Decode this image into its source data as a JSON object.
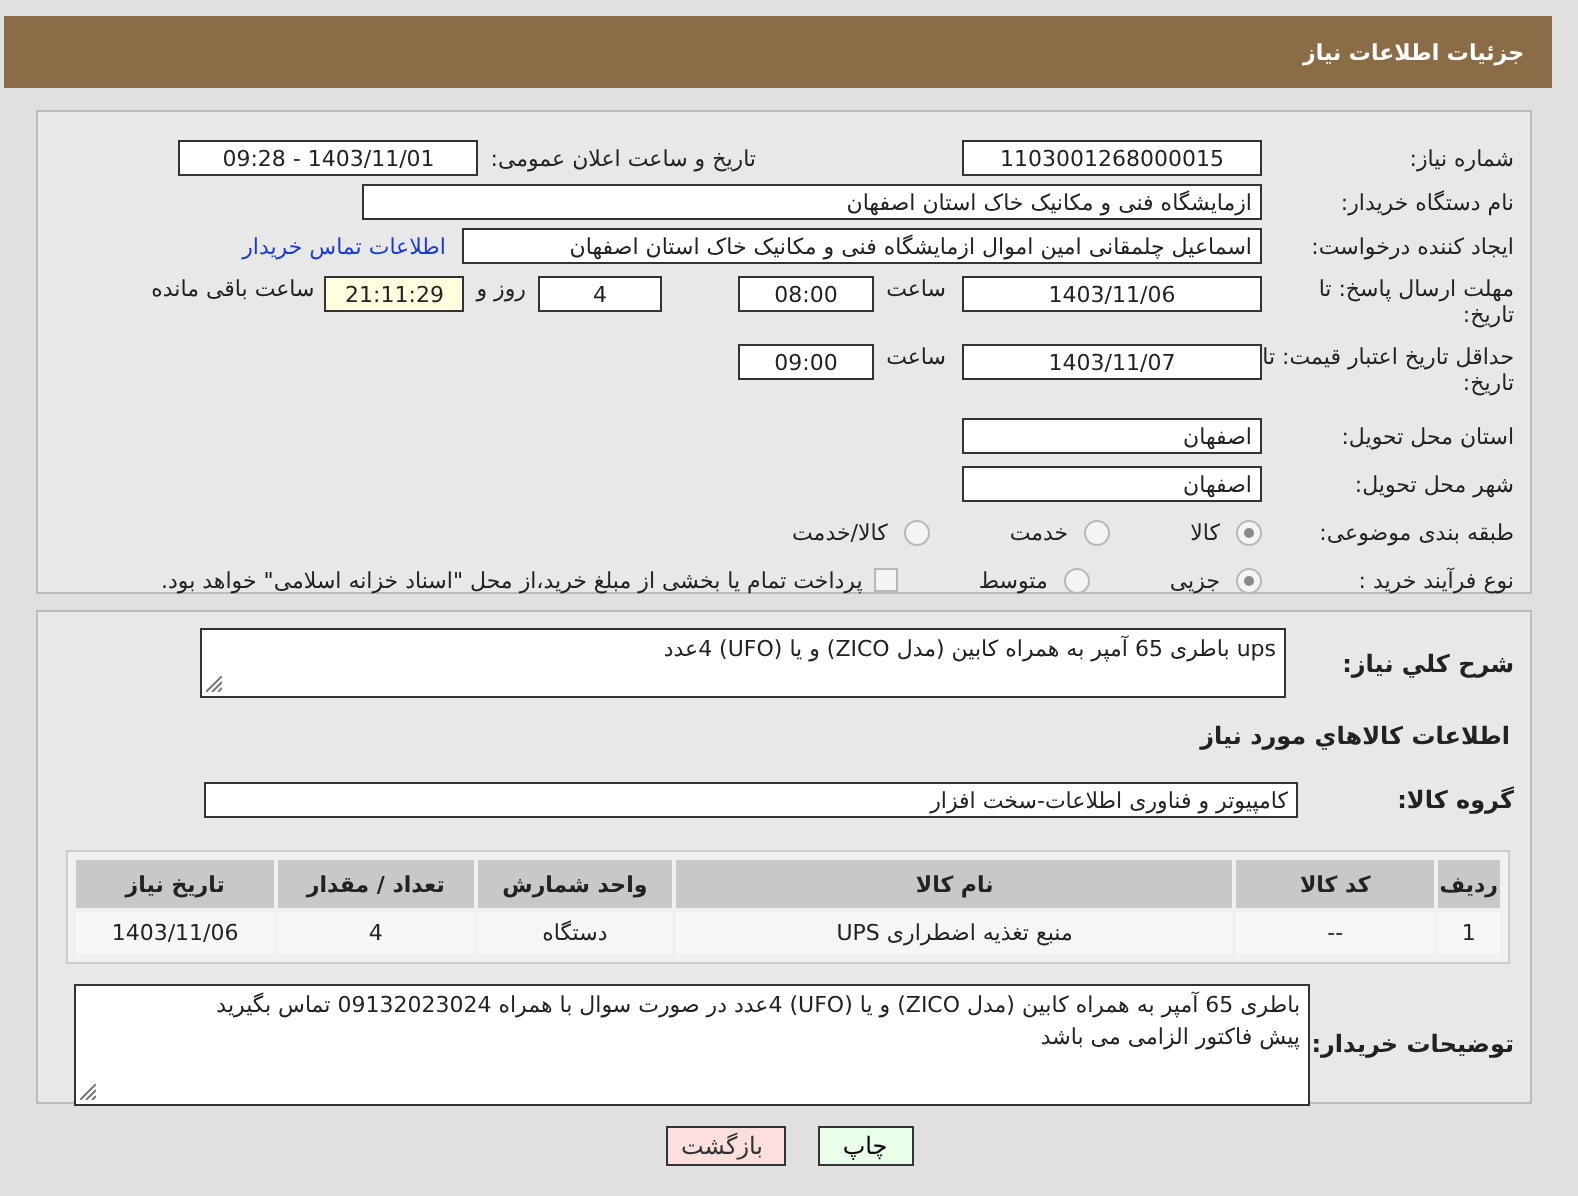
{
  "header": {
    "title": "جزئیات اطلاعات نیاز"
  },
  "need_number": {
    "label": "شماره نیاز:",
    "value": "1103001268000015"
  },
  "announce": {
    "label": "تاریخ و ساعت اعلان عمومی:",
    "value": "1403/11/01 - 09:28"
  },
  "buyer_org": {
    "label": "نام دستگاه خریدار:",
    "value": "ازمایشگاه فنی و مکانیک خاک استان اصفهان"
  },
  "requester": {
    "label": "ایجاد کننده درخواست:",
    "value": "اسماعیل چلمقانی امین اموال ازمایشگاه فنی و مکانیک خاک استان اصفهان",
    "link": "اطلاعات تماس خریدار"
  },
  "reply_deadline": {
    "label": "مهلت ارسال پاسخ: تا تاریخ:",
    "date": "1403/11/06",
    "time_label": "ساعت",
    "time": "08:00",
    "days": "4",
    "days_label": "روز و",
    "remaining": "21:11:29",
    "remaining_label": "ساعت باقی مانده"
  },
  "price_validity": {
    "label": "حداقل تاریخ اعتبار قیمت: تا تاریخ:",
    "date": "1403/11/07",
    "time_label": "ساعت",
    "time": "09:00"
  },
  "province": {
    "label": "استان محل تحویل:",
    "value": "اصفهان"
  },
  "city": {
    "label": "شهر محل تحویل:",
    "value": "اصفهان"
  },
  "category": {
    "label": "طبقه بندی موضوعی:",
    "options": [
      {
        "label": "کالا",
        "selected": true
      },
      {
        "label": "خدمت",
        "selected": false
      },
      {
        "label": "کالا/خدمت",
        "selected": false
      }
    ]
  },
  "purchase_type": {
    "label": "نوع فرآیند خرید :",
    "options": [
      {
        "label": "جزیی",
        "selected": true
      },
      {
        "label": "متوسط",
        "selected": false
      }
    ],
    "payment": {
      "checked": false,
      "text": "پرداخت تمام یا بخشی از مبلغ خرید،از محل \"اسناد خزانه اسلامی\" خواهد بود."
    }
  },
  "description": {
    "label": "شرح کلي نياز:",
    "value": "ups باطری 65 آمپر به همراه کابین (مدل ZICO) و یا (UFO) 4عدد"
  },
  "goods_title": "اطلاعات کالاهاي مورد نياز",
  "goods_group": {
    "label": "گروه کالا:",
    "value": "کامپیوتر و فناوری اطلاعات-سخت افزار"
  },
  "table": {
    "columns": [
      "ردیف",
      "کد کالا",
      "نام کالا",
      "واحد شمارش",
      "تعداد / مقدار",
      "تاریخ نیاز"
    ],
    "rows": [
      [
        "1",
        "--",
        "منبع تغذیه اضطراری UPS",
        "دستگاه",
        "4",
        "1403/11/06"
      ]
    ]
  },
  "buyer_notes": {
    "label": "توضیحات خریدار:",
    "lines": [
      "باطری 65 آمپر به همراه کابین (مدل ZICO) و یا (UFO) 4عدد در صورت سوال با همراه 09132023024 تماس بگیرید",
      "پیش فاکتور الزامی می باشد"
    ]
  },
  "buttons": [
    {
      "label": "چاپ",
      "kind": "print"
    },
    {
      "label": "بازگشت",
      "kind": "back"
    }
  ]
}
